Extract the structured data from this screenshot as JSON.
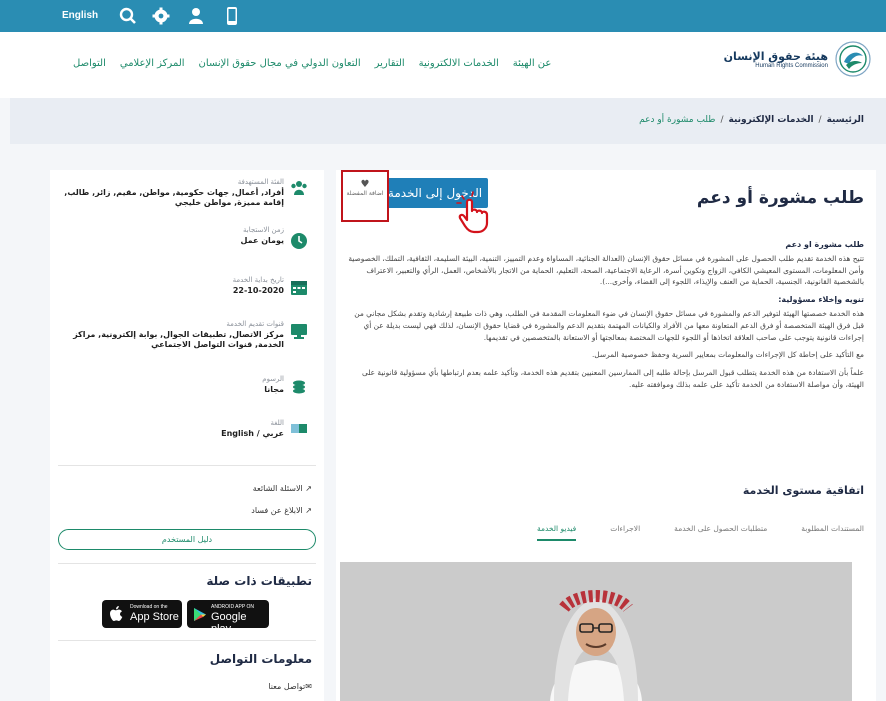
{
  "topbar": {
    "language": "English",
    "icons": [
      "search-icon",
      "gear-icon",
      "user-icon",
      "phone-icon"
    ],
    "color": "#2a8db3"
  },
  "header": {
    "nav": [
      "عن الهيئة",
      "الخدمات الالكترونية",
      "التقارير",
      "التعاون الدولي في مجال حقوق الإنسان",
      "المركز الإعلامي",
      "التواصل"
    ],
    "logo_ar": "هيئة حقوق الإنسان",
    "logo_en": "Human Rights Commission"
  },
  "breadcrumb": {
    "home": "الرئيسية",
    "sep": "/",
    "section": "الخدمات الإلكترونية",
    "current": "طلب مشورة أو دعم"
  },
  "main": {
    "title": "طلب مشورة أو دعم",
    "get_service": "الدخول إلى الخدمة",
    "favorite": "اضافة المفضلة",
    "section1_title": "طلب مشورة او دعم",
    "section1_text": "تتيح هذه الخدمة تقديم طلب الحصول على المشورة في مسائل حقوق الإنسان (العدالة الجنائية، المساواة وعدم التمييز، التنمية، البيئة السليمة، الثقافية، التملك، الخصوصية وأمن المعلومات، المستوى المعيشي الكافي، الزواج وتكوين أسرة، الرعاية الاجتماعية، الصحة، التعليم، الحماية من الاتجار بالأشخاص، العمل، الرأي والتعبير، الاعتراف بالشخصية القانونية، الجنسية، الحماية من العنف والإيذاء، اللجوء إلى القضاء، وأخرى...).",
    "section2_title": "تنويه وإخلاء مسؤولية:",
    "section2_text": "هذه الخدمة خصصتها الهيئة لتوفير الدعم والمشورة في مسائل حقوق الإنسان في ضوء المعلومات المقدمة في الطلب، وهي ذات طبيعة إرشادية وتقدم بشكل مجاني من قبل فرق الهيئة المتخصصة أو فرق الدعم المتعاونة معها من الأفراد والكيانات المهتمة بتقديم الدعم والمشورة في قضايا حقوق الإنسان، لذلك فهي ليست بديلة عن أي إجراءات قانونية يتوجب على صاحب العلاقة اتخاذها أو اللجوء للجهات المختصة بمعالجتها أو الاستعانة بالمتخصصين في تقديمها.",
    "para3": "مع التأكيد على إحاطة كل الإجراءات والمعلومات بمعايير السرية وحفظ خصوصية المرسل.",
    "para4": "علماً بأن الاستفادة من هذه الخدمة يتطلب قبول المرسل بإحالة طلبه إلى الممارسين المعنيين بتقديم هذه الخدمة، وتأكيد علمه بعدم ارتباطها بأي مسؤولية قانونية على الهيئة، وأن مواصلة الاستفادة من الخدمة تأكيد على علمه بذلك وموافقته عليه.",
    "sla_title": "اتفاقية مستوى الخدمة",
    "tabs": [
      "فيديو الخدمة",
      "الاجراءات",
      "متطلبات الحصول على الخدمة",
      "المستندات المطلوبة"
    ]
  },
  "sidebar": {
    "beneficiaries_label": "الفئة المستهدفة",
    "beneficiaries_value": "أفراد, أعمال, جهات حكومية, مواطن, مقيم, زائر, طالب, إقامة مميزة, مواطن خليجي",
    "response_label": "زمن الاستجابة",
    "response_value": "يومان عمل",
    "start_label": "تاريخ بداية الخدمة",
    "start_value": "22-10-2020",
    "channels_label": "قنوات تقديم الخدمة",
    "channels_value": "مركز الاتصال, تطبيقات الجوال, بوابة إلكترونية, مراكز الخدمة, قنوات التواصل الاجتماعي",
    "fees_label": "الرسوم",
    "fees_value": "مجانا",
    "lang_label": "اللغة",
    "lang_value": "عربي / English",
    "faq": "الاسئلة الشائعة",
    "report": "الابلاغ عن فساد",
    "guide": "دليل المستخدم",
    "apps_title": "تطبيقات ذات صلة",
    "appstore_small": "Download on the",
    "appstore_big": "App Store",
    "gplay_small": "ANDROID APP ON",
    "gplay_big": "Google play",
    "contact_title": "معلومات التواصل",
    "contact_link": "تواصل معنا"
  },
  "colors": {
    "accent": "#1d8a6a",
    "blue": "#1f7fb8",
    "highlight": "#c0141b"
  }
}
